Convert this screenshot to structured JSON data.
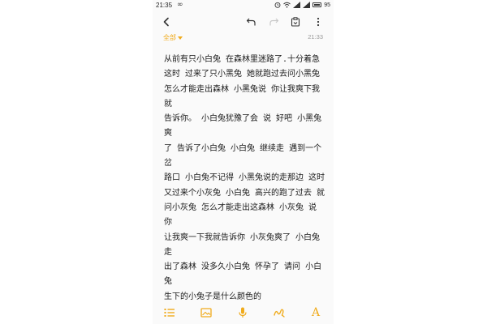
{
  "status_bar": {
    "time": "21:35",
    "infinity_glyph": "∞",
    "battery_level": "95"
  },
  "toolbar": {
    "back_icon": "back-arrow-icon",
    "undo_icon": "undo-icon",
    "redo_icon": "redo-icon",
    "share_icon": "share-icon",
    "more_icon": "more-vertical-icon"
  },
  "note": {
    "folder_label": "全部",
    "time": "21:33",
    "body": "从前有只小白兔 在森林里迷路了.十分着急\n这时 过来了只小黑兔 她就跑过去问小黑兔\n怎么才能走出森林 小黑兔说 你让我爽下我就\n告诉你。 小白兔犹豫了会 说 好吧 小黑兔爽\n了 告诉了小白兔 小白兔 继续走 遇到一个岔\n路口 小白兔不记得 小黑兔说的走那边 这时\n又过来个小灰兔 小白兔 高兴的跑了过去 就\n问小灰兔 怎么才能走出这森林 小灰兔 说 你\n让我爽一下我就告诉你 小灰兔爽了 小白兔走\n出了森林 没多久小白兔 怀孕了 请问 小白兔\n生下的小兔子是什么颜色的"
  },
  "bottom_bar": {
    "list_icon": "checklist-icon",
    "image_icon": "image-icon",
    "mic_icon": "microphone-icon",
    "draw_icon": "handwriting-icon",
    "font_glyph": "A"
  },
  "colors": {
    "accent": "#f0ab1c",
    "text": "#1a1a1a",
    "icon_dark": "#333333",
    "icon_disabled": "#c8c8c8",
    "background": "#fafafa"
  }
}
